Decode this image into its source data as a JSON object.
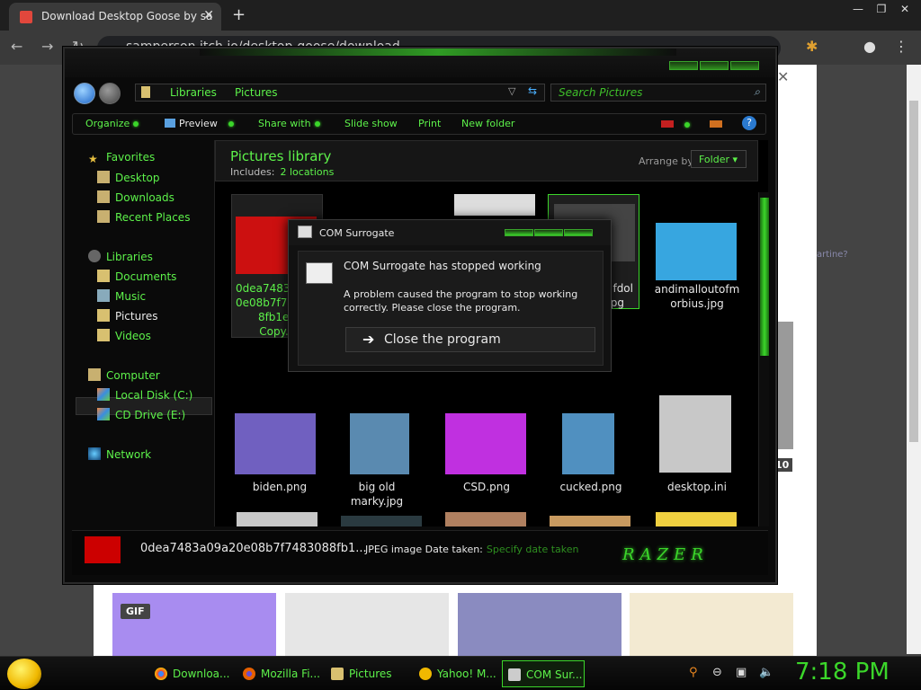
{
  "browser": {
    "tab_title": "Download Desktop Goose by sa",
    "tab_close": "✕",
    "new_tab": "+",
    "url": "samperson.itch.io/desktop-goose/download",
    "window_controls": [
      "—",
      "❐",
      "✕"
    ]
  },
  "explorer": {
    "breadcrumb": [
      "Libraries",
      "Pictures"
    ],
    "search_placeholder": "Search Pictures",
    "commands": [
      "Organize",
      "Preview",
      "Share with",
      "Slide show",
      "Print",
      "New folder"
    ],
    "nav": {
      "favorites": "Favorites",
      "desktop": "Desktop",
      "downloads": "Downloads",
      "recent": "Recent Places",
      "libraries": "Libraries",
      "documents": "Documents",
      "music": "Music",
      "pictures": "Pictures",
      "videos": "Videos",
      "computer": "Computer",
      "local_disk": "Local Disk (C:)",
      "cd_drive": "CD Drive (E:)",
      "network": "Network"
    },
    "library": {
      "title": "Pictures library",
      "includes_label": "Includes:",
      "locations": "2 locations",
      "arrange_label": "Arrange by:",
      "arrange_value": "Folder ▾"
    },
    "files": [
      {
        "name1": "0dea7483a",
        "name2": "0e08b7f74",
        "name3": "8fb1ed",
        "name4": "Copy.jp"
      },
      {
        "name1": "fdol",
        "name2": "pg"
      },
      {
        "name1": "andimalloutofm",
        "name2": "orbius.jpg"
      },
      {
        "name1": "biden.png"
      },
      {
        "name1": "big old",
        "name2": "marky.jpg"
      },
      {
        "name1": "CSD.png"
      },
      {
        "name1": "cucked.png"
      },
      {
        "name1": "desktop.ini"
      }
    ],
    "details": {
      "filename": "0dea7483a09a20e08b7f7483088fb1...",
      "type": "JPEG image",
      "date_label": "Date taken:",
      "date_value": "Specify date taken"
    },
    "brand": "RAZER"
  },
  "dialog": {
    "title": "COM Surrogate",
    "heading": "COM Surrogate has stopped working",
    "message": "A problem caused the program to stop working correctly. Please close the program.",
    "button": "Close the program"
  },
  "page_behind": {
    "gif_badge": "GIF",
    "count_badge": "10",
    "side_text": "artine?"
  },
  "taskbar": {
    "tasks": [
      {
        "label": "Downloa...",
        "icon_color": "#4285f4"
      },
      {
        "label": "Mozilla Fi...",
        "icon_color": "#e66000"
      },
      {
        "label": "Pictures",
        "icon_color": "#d8c070"
      },
      {
        "label": "Yahoo! M...",
        "icon_color": "#f0b800"
      },
      {
        "label": "COM Sur...",
        "icon_color": "#cccccc"
      }
    ],
    "clock": "7:18 PM"
  },
  "colors": {
    "accent_green": "#3bd62a",
    "text_green": "#5df24a"
  }
}
